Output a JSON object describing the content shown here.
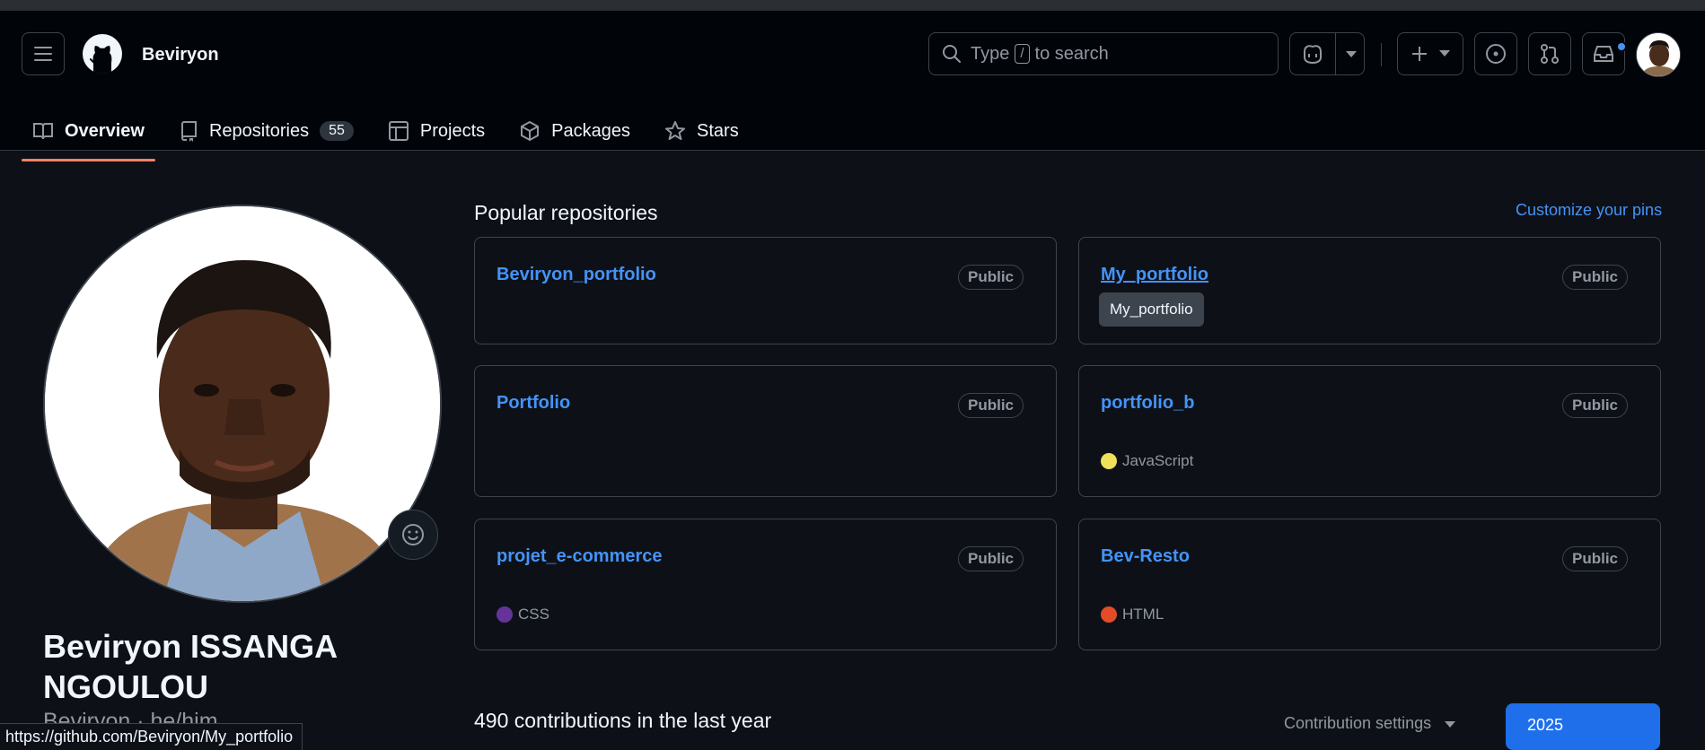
{
  "colors": {
    "background": "#0d1117",
    "header": "#010409",
    "link": "#4493f8",
    "active_tab_underline": "#f78166",
    "primary_button": "#1f6feb"
  },
  "header": {
    "username": "Beviryon",
    "search": {
      "prefix": "Type",
      "key": "/",
      "suffix": "to search"
    },
    "icons": [
      "menu-icon",
      "github-logo-icon",
      "search-icon",
      "copilot-icon",
      "plus-icon",
      "issues-icon",
      "pull-request-icon",
      "inbox-icon"
    ]
  },
  "tabs": [
    {
      "label": "Overview",
      "icon": "book-icon",
      "active": true
    },
    {
      "label": "Repositories",
      "icon": "repo-icon",
      "count": "55"
    },
    {
      "label": "Projects",
      "icon": "table-icon"
    },
    {
      "label": "Packages",
      "icon": "package-icon"
    },
    {
      "label": "Stars",
      "icon": "star-icon"
    }
  ],
  "profile": {
    "full_name": "Beviryon ISSANGA NGOULOU",
    "login_line": "Beviryon · he/him"
  },
  "popular": {
    "title": "Popular repositories",
    "customize_link": "Customize your pins",
    "repos": [
      {
        "name": "Beviryon_portfolio",
        "visibility": "Public",
        "language": "",
        "lang_color": ""
      },
      {
        "name": "My_portfolio",
        "visibility": "Public",
        "language": "",
        "lang_color": "",
        "tooltip": "My_portfolio"
      },
      {
        "name": "Portfolio",
        "visibility": "Public",
        "language": "",
        "lang_color": ""
      },
      {
        "name": "portfolio_b",
        "visibility": "Public",
        "language": "JavaScript",
        "lang_color": "#f1e05a"
      },
      {
        "name": "projet_e-commerce",
        "visibility": "Public",
        "language": "CSS",
        "lang_color": "#663399"
      },
      {
        "name": "Bev-Resto",
        "visibility": "Public",
        "language": "HTML",
        "lang_color": "#e34c26"
      }
    ]
  },
  "contributions": {
    "summary": "490 contributions in the last year",
    "settings_label": "Contribution settings",
    "year": "2025"
  },
  "status_url": "https://github.com/Beviryon/My_portfolio"
}
